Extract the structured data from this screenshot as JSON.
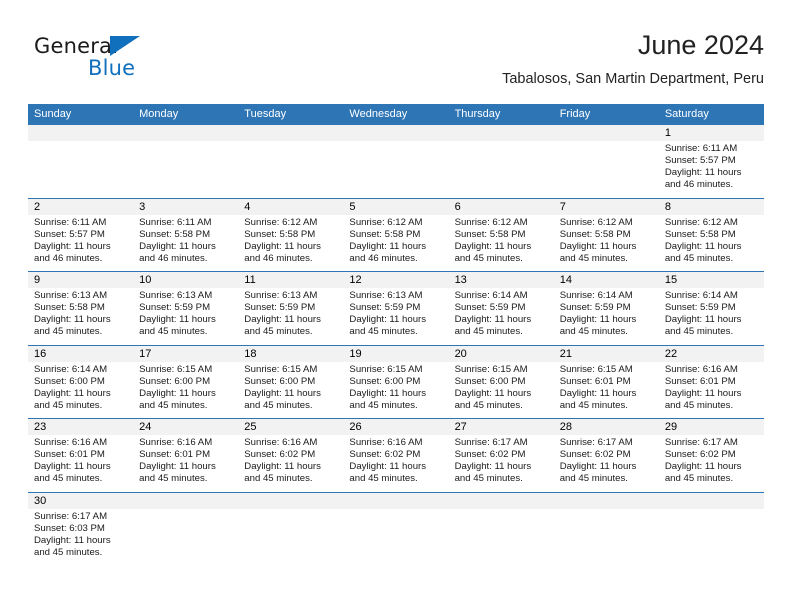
{
  "logo": {
    "word_one": "General",
    "word_two": "Blue",
    "triangle_color": "#1170bd"
  },
  "header": {
    "title": "June 2024",
    "subtitle": "Tabalosos, San Martin Department, Peru"
  },
  "colors": {
    "header_blue": "#2e75b6",
    "day_band_gray": "#f2f2f2",
    "row_rule_blue": "#2e75b6"
  },
  "calendar": {
    "day_names": [
      "Sunday",
      "Monday",
      "Tuesday",
      "Wednesday",
      "Thursday",
      "Friday",
      "Saturday"
    ],
    "weeks": [
      [
        {
          "empty": true
        },
        {
          "empty": true
        },
        {
          "empty": true
        },
        {
          "empty": true
        },
        {
          "empty": true
        },
        {
          "empty": true
        },
        {
          "day": "1",
          "sunrise": "Sunrise: 6:11 AM",
          "sunset": "Sunset: 5:57 PM",
          "daylight1": "Daylight: 11 hours",
          "daylight2": "and 46 minutes."
        }
      ],
      [
        {
          "day": "2",
          "sunrise": "Sunrise: 6:11 AM",
          "sunset": "Sunset: 5:57 PM",
          "daylight1": "Daylight: 11 hours",
          "daylight2": "and 46 minutes."
        },
        {
          "day": "3",
          "sunrise": "Sunrise: 6:11 AM",
          "sunset": "Sunset: 5:58 PM",
          "daylight1": "Daylight: 11 hours",
          "daylight2": "and 46 minutes."
        },
        {
          "day": "4",
          "sunrise": "Sunrise: 6:12 AM",
          "sunset": "Sunset: 5:58 PM",
          "daylight1": "Daylight: 11 hours",
          "daylight2": "and 46 minutes."
        },
        {
          "day": "5",
          "sunrise": "Sunrise: 6:12 AM",
          "sunset": "Sunset: 5:58 PM",
          "daylight1": "Daylight: 11 hours",
          "daylight2": "and 46 minutes."
        },
        {
          "day": "6",
          "sunrise": "Sunrise: 6:12 AM",
          "sunset": "Sunset: 5:58 PM",
          "daylight1": "Daylight: 11 hours",
          "daylight2": "and 45 minutes."
        },
        {
          "day": "7",
          "sunrise": "Sunrise: 6:12 AM",
          "sunset": "Sunset: 5:58 PM",
          "daylight1": "Daylight: 11 hours",
          "daylight2": "and 45 minutes."
        },
        {
          "day": "8",
          "sunrise": "Sunrise: 6:12 AM",
          "sunset": "Sunset: 5:58 PM",
          "daylight1": "Daylight: 11 hours",
          "daylight2": "and 45 minutes."
        }
      ],
      [
        {
          "day": "9",
          "sunrise": "Sunrise: 6:13 AM",
          "sunset": "Sunset: 5:58 PM",
          "daylight1": "Daylight: 11 hours",
          "daylight2": "and 45 minutes."
        },
        {
          "day": "10",
          "sunrise": "Sunrise: 6:13 AM",
          "sunset": "Sunset: 5:59 PM",
          "daylight1": "Daylight: 11 hours",
          "daylight2": "and 45 minutes."
        },
        {
          "day": "11",
          "sunrise": "Sunrise: 6:13 AM",
          "sunset": "Sunset: 5:59 PM",
          "daylight1": "Daylight: 11 hours",
          "daylight2": "and 45 minutes."
        },
        {
          "day": "12",
          "sunrise": "Sunrise: 6:13 AM",
          "sunset": "Sunset: 5:59 PM",
          "daylight1": "Daylight: 11 hours",
          "daylight2": "and 45 minutes."
        },
        {
          "day": "13",
          "sunrise": "Sunrise: 6:14 AM",
          "sunset": "Sunset: 5:59 PM",
          "daylight1": "Daylight: 11 hours",
          "daylight2": "and 45 minutes."
        },
        {
          "day": "14",
          "sunrise": "Sunrise: 6:14 AM",
          "sunset": "Sunset: 5:59 PM",
          "daylight1": "Daylight: 11 hours",
          "daylight2": "and 45 minutes."
        },
        {
          "day": "15",
          "sunrise": "Sunrise: 6:14 AM",
          "sunset": "Sunset: 5:59 PM",
          "daylight1": "Daylight: 11 hours",
          "daylight2": "and 45 minutes."
        }
      ],
      [
        {
          "day": "16",
          "sunrise": "Sunrise: 6:14 AM",
          "sunset": "Sunset: 6:00 PM",
          "daylight1": "Daylight: 11 hours",
          "daylight2": "and 45 minutes."
        },
        {
          "day": "17",
          "sunrise": "Sunrise: 6:15 AM",
          "sunset": "Sunset: 6:00 PM",
          "daylight1": "Daylight: 11 hours",
          "daylight2": "and 45 minutes."
        },
        {
          "day": "18",
          "sunrise": "Sunrise: 6:15 AM",
          "sunset": "Sunset: 6:00 PM",
          "daylight1": "Daylight: 11 hours",
          "daylight2": "and 45 minutes."
        },
        {
          "day": "19",
          "sunrise": "Sunrise: 6:15 AM",
          "sunset": "Sunset: 6:00 PM",
          "daylight1": "Daylight: 11 hours",
          "daylight2": "and 45 minutes."
        },
        {
          "day": "20",
          "sunrise": "Sunrise: 6:15 AM",
          "sunset": "Sunset: 6:00 PM",
          "daylight1": "Daylight: 11 hours",
          "daylight2": "and 45 minutes."
        },
        {
          "day": "21",
          "sunrise": "Sunrise: 6:15 AM",
          "sunset": "Sunset: 6:01 PM",
          "daylight1": "Daylight: 11 hours",
          "daylight2": "and 45 minutes."
        },
        {
          "day": "22",
          "sunrise": "Sunrise: 6:16 AM",
          "sunset": "Sunset: 6:01 PM",
          "daylight1": "Daylight: 11 hours",
          "daylight2": "and 45 minutes."
        }
      ],
      [
        {
          "day": "23",
          "sunrise": "Sunrise: 6:16 AM",
          "sunset": "Sunset: 6:01 PM",
          "daylight1": "Daylight: 11 hours",
          "daylight2": "and 45 minutes."
        },
        {
          "day": "24",
          "sunrise": "Sunrise: 6:16 AM",
          "sunset": "Sunset: 6:01 PM",
          "daylight1": "Daylight: 11 hours",
          "daylight2": "and 45 minutes."
        },
        {
          "day": "25",
          "sunrise": "Sunrise: 6:16 AM",
          "sunset": "Sunset: 6:02 PM",
          "daylight1": "Daylight: 11 hours",
          "daylight2": "and 45 minutes."
        },
        {
          "day": "26",
          "sunrise": "Sunrise: 6:16 AM",
          "sunset": "Sunset: 6:02 PM",
          "daylight1": "Daylight: 11 hours",
          "daylight2": "and 45 minutes."
        },
        {
          "day": "27",
          "sunrise": "Sunrise: 6:17 AM",
          "sunset": "Sunset: 6:02 PM",
          "daylight1": "Daylight: 11 hours",
          "daylight2": "and 45 minutes."
        },
        {
          "day": "28",
          "sunrise": "Sunrise: 6:17 AM",
          "sunset": "Sunset: 6:02 PM",
          "daylight1": "Daylight: 11 hours",
          "daylight2": "and 45 minutes."
        },
        {
          "day": "29",
          "sunrise": "Sunrise: 6:17 AM",
          "sunset": "Sunset: 6:02 PM",
          "daylight1": "Daylight: 11 hours",
          "daylight2": "and 45 minutes."
        }
      ],
      [
        {
          "day": "30",
          "sunrise": "Sunrise: 6:17 AM",
          "sunset": "Sunset: 6:03 PM",
          "daylight1": "Daylight: 11 hours",
          "daylight2": "and 45 minutes."
        },
        {
          "empty": true
        },
        {
          "empty": true
        },
        {
          "empty": true
        },
        {
          "empty": true
        },
        {
          "empty": true
        },
        {
          "empty": true
        }
      ]
    ]
  }
}
